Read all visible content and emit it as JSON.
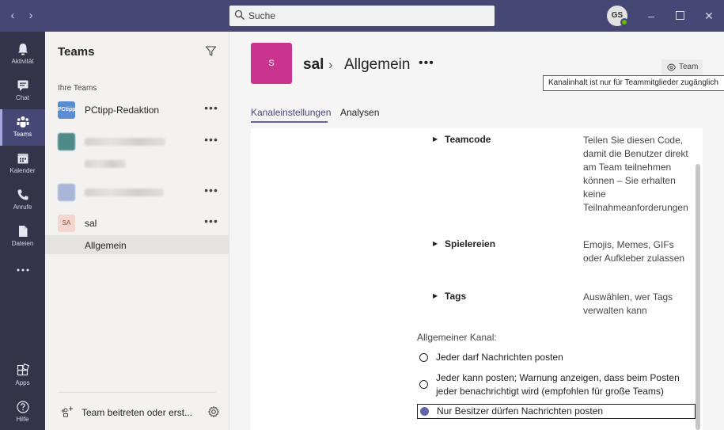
{
  "titlebar": {
    "search": {
      "placeholder": "Suche"
    },
    "user_initials": "GS"
  },
  "rail": {
    "items": [
      {
        "label": "Aktivität",
        "icon": "bell-icon",
        "active": false
      },
      {
        "label": "Chat",
        "icon": "chat-icon",
        "active": false
      },
      {
        "label": "Teams",
        "icon": "teams-icon",
        "active": true
      },
      {
        "label": "Kalender",
        "icon": "calendar-icon",
        "active": false
      },
      {
        "label": "Anrufe",
        "icon": "phone-icon",
        "active": false
      },
      {
        "label": "Dateien",
        "icon": "file-icon",
        "active": false
      },
      {
        "label": "Apps",
        "icon": "apps-icon",
        "active": false
      },
      {
        "label": "Hilfe",
        "icon": "help-icon",
        "active": false
      }
    ]
  },
  "teams_panel": {
    "title": "Teams",
    "section_label": "Ihre Teams",
    "teams": [
      {
        "name": "PCtipp-Redaktion",
        "tile": "PCtipp",
        "tile_color": "#5b8bd0"
      },
      {
        "name": "",
        "tile": "",
        "tile_color": "#4e8a8a"
      },
      {
        "name": "",
        "tile": "",
        "tile_color": "#a8b6d8"
      },
      {
        "name": "sal",
        "tile": "SA",
        "tile_color": "#f3d6cf"
      }
    ],
    "active_channel": "Allgemein",
    "join_label": "Team beitreten oder erst..."
  },
  "main": {
    "channel_tile": "S",
    "breadcrumb": {
      "team": "sal",
      "channel": "Allgemein"
    },
    "team_badge": "Team",
    "tooltip": "Kanalinhalt ist nur für Teammitglieder zugänglich",
    "tabs": [
      {
        "label": "Kanaleinstellungen",
        "active": true
      },
      {
        "label": "Analysen",
        "active": false
      }
    ],
    "settings": [
      {
        "title": "Teamcode",
        "desc": "Teilen Sie diesen Code, damit die Benutzer direkt am Team teilnehmen können – Sie erhalten keine Teilnahmeanforderungen"
      },
      {
        "title": "Spielereien",
        "desc": "Emojis, Memes, GIFs oder Aufkleber zulassen"
      },
      {
        "title": "Tags",
        "desc": "Auswählen, wer Tags verwalten kann"
      }
    ],
    "general_channel": {
      "label": "Allgemeiner Kanal:",
      "options": [
        {
          "label": "Jeder darf Nachrichten posten",
          "checked": false
        },
        {
          "label": "Jeder kann posten; Warnung anzeigen, dass beim Posten jeder benachrichtigt wird (empfohlen für große Teams)",
          "checked": false
        },
        {
          "label": "Nur Besitzer dürfen Nachrichten posten",
          "checked": true
        }
      ]
    }
  },
  "colors": {
    "brand": "#464775",
    "accent": "#6264a7",
    "rail": "#33344a",
    "channel_tile": "#c8348e"
  }
}
